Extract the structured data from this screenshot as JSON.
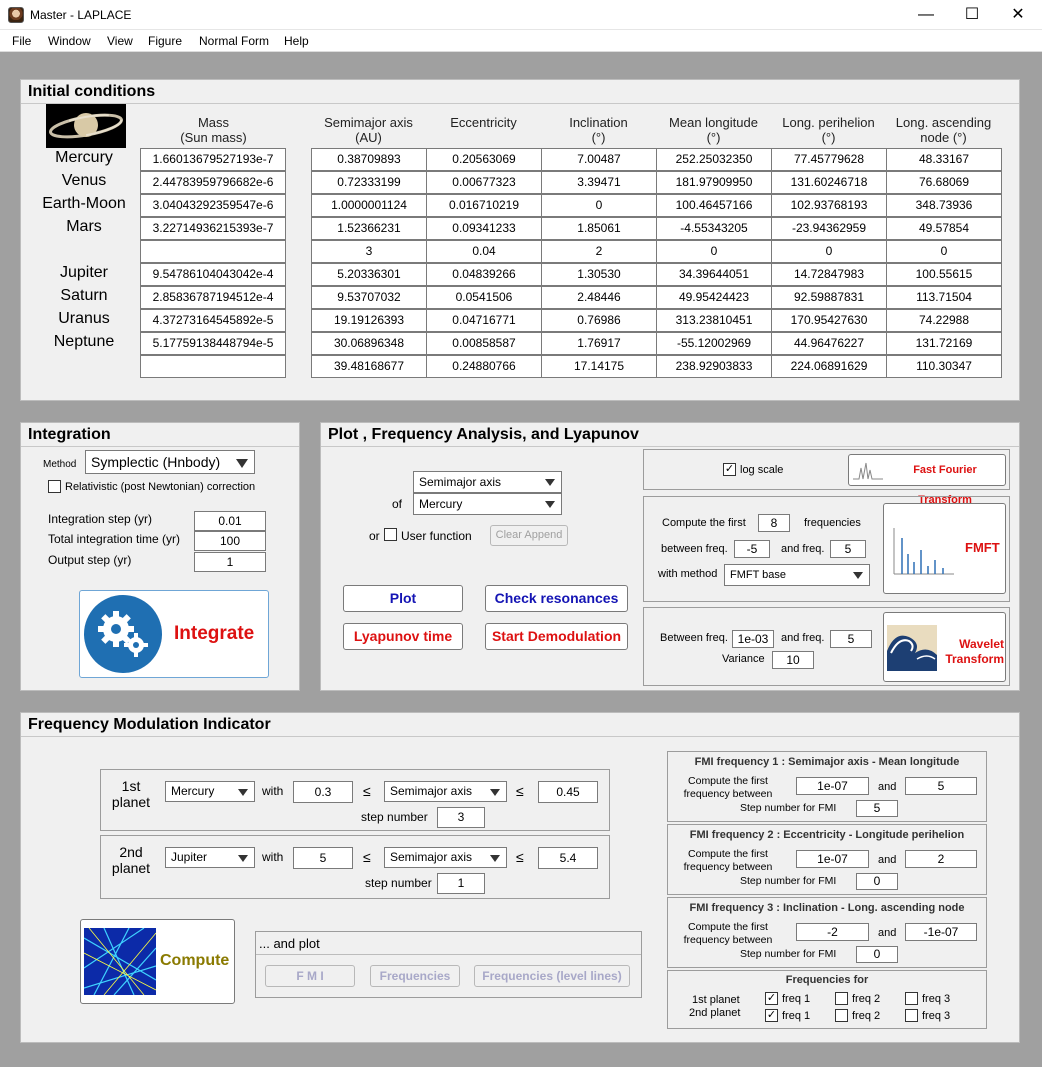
{
  "window": {
    "title": "Master - LAPLACE",
    "minimize": "—",
    "maximize": "☐",
    "close": "✕"
  },
  "menu": [
    "File",
    "Window",
    "View",
    "Figure",
    "Normal Form",
    "Help"
  ],
  "initial": {
    "title": "Initial conditions",
    "mass_header": [
      "Mass",
      "(Sun mass)"
    ],
    "col_headers": [
      [
        "Semimajor axis",
        "(AU)"
      ],
      [
        "Eccentricity",
        ""
      ],
      [
        "Inclination",
        "(°)"
      ],
      [
        "Mean longitude",
        "(°)"
      ],
      [
        "Long. perihelion",
        "(°)"
      ],
      [
        "Long. ascending",
        "node (°)"
      ]
    ],
    "planets": [
      "Mercury",
      "Venus",
      "Earth-Moon",
      "Mars",
      "",
      "Jupiter",
      "Saturn",
      "Uranus",
      "Neptune",
      ""
    ],
    "masses": [
      "1.66013679527193e-7",
      "2.44783959796682e-6",
      "3.04043292359547e-6",
      "3.22714936215393e-7",
      "",
      "9.54786104043042e-4",
      "2.85836787194512e-4",
      "4.37273164545892e-5",
      "5.17759138448794e-5",
      ""
    ],
    "rows": [
      [
        "0.38709893",
        "0.20563069",
        "7.00487",
        "252.25032350",
        "77.45779628",
        "48.33167"
      ],
      [
        "0.72333199",
        "0.00677323",
        "3.39471",
        "181.97909950",
        "131.60246718",
        "76.68069"
      ],
      [
        "1.0000001124",
        "0.016710219",
        "0",
        "100.46457166",
        "102.93768193",
        "348.73936"
      ],
      [
        "1.52366231",
        "0.09341233",
        "1.85061",
        "-4.55343205",
        "-23.94362959",
        "49.57854"
      ],
      [
        "3",
        "0.04",
        "2",
        "0",
        "0",
        "0"
      ],
      [
        "5.20336301",
        "0.04839266",
        "1.30530",
        "34.39644051",
        "14.72847983",
        "100.55615"
      ],
      [
        "9.53707032",
        "0.0541506",
        "2.48446",
        "49.95424423",
        "92.59887831",
        "113.71504"
      ],
      [
        "19.19126393",
        "0.04716771",
        "0.76986",
        "313.23810451",
        "170.95427630",
        "74.22988"
      ],
      [
        "30.06896348",
        "0.00858587",
        "1.76917",
        "-55.12002969",
        "44.96476227",
        "131.72169"
      ],
      [
        "39.48168677",
        "0.24880766",
        "17.14175",
        "238.92903833",
        "224.06891629",
        "110.30347"
      ]
    ]
  },
  "integration": {
    "title": "Integration",
    "method_label": "Method",
    "method_value": "Symplectic (Hnbody)",
    "relativistic_label": "Relativistic (post Newtonian) correction",
    "step_label": "Integration step (yr)",
    "step_value": "0.01",
    "total_label": "Total integration time (yr)",
    "total_value": "100",
    "output_label": "Output step (yr)",
    "output_value": "1",
    "integrate_label": "Integrate"
  },
  "plot": {
    "title": "Plot , Frequency Analysis, and Lyapunov",
    "variable": "Semimajor axis",
    "of_label": "of",
    "planet": "Mercury",
    "or_label": "or",
    "user_function_label": "User function",
    "clear_append": "Clear Append",
    "plot_btn": "Plot",
    "resonances_btn": "Check resonances",
    "lyapunov_btn": "Lyapunov time",
    "demod_btn": "Start Demodulation",
    "log_scale_label": "log scale",
    "fft_label": "Fast Fourier Transform",
    "compute_first_label": "Compute the first",
    "compute_first_value": "8",
    "frequencies_label": "frequencies",
    "between_label": "between freq.",
    "between_value": "-5",
    "and_freq_label": "and freq.",
    "and_freq_value": "5",
    "with_method_label": "with method",
    "method_value": "FMFT base",
    "fmft_label": "FMFT",
    "wav_between_label": "Between freq.",
    "wav_between_value": "1e-03",
    "wav_and_label": "and freq.",
    "wav_and_value": "5",
    "variance_label": "Variance",
    "variance_value": "10",
    "wavelet_label_1": "Wavelet",
    "wavelet_label_2": "Transform"
  },
  "fmi": {
    "title": "Frequency Modulation Indicator",
    "p1_label_1": "1st",
    "p1_label_2": "planet",
    "p1_planet": "Mercury",
    "with_label": "with",
    "p1_min": "0.3",
    "le": "≤",
    "p1_var": "Semimajor axis",
    "p1_max": "0.45",
    "step_number_label": "step number",
    "p1_steps": "3",
    "p2_label_1": "2nd",
    "p2_label_2": "planet",
    "p2_planet": "Jupiter",
    "p2_min": "5",
    "p2_var": "Semimajor axis",
    "p2_max": "5.4",
    "p2_steps": "1",
    "compute_label": "Compute",
    "and_plot_label": "... and plot",
    "fmi_btn": "F M I",
    "freq_btn": "Frequencies",
    "freq_levels_btn": "Frequencies (level lines)",
    "f1_title": "FMI frequency 1 :   Semimajor axis - Mean longitude",
    "f2_title": "FMI frequency 2 :   Eccentricity - Longitude perihelion",
    "f3_title": "FMI frequency 3 :   Inclination - Long. ascending node",
    "compute_first_1": "Compute the first",
    "compute_first_2": "frequency between",
    "and_label": "and",
    "step_fmi_label": "Step number for FMI",
    "f1_a": "1e-07",
    "f1_b": "5",
    "f1_steps": "5",
    "f2_a": "1e-07",
    "f2_b": "2",
    "f2_steps": "0",
    "f3_a": "-2",
    "f3_b": "-1e-07",
    "f3_steps": "0",
    "frequencies_for": "Frequencies for",
    "first_planet": "1st planet",
    "second_planet": "2nd planet",
    "freq1": "freq 1",
    "freq2": "freq 2",
    "freq3": "freq 3"
  },
  "colors": {
    "red": "#dd1111",
    "blue": "#1414b4",
    "olive": "#8a7a00",
    "disabled": "#a8a8c8"
  }
}
